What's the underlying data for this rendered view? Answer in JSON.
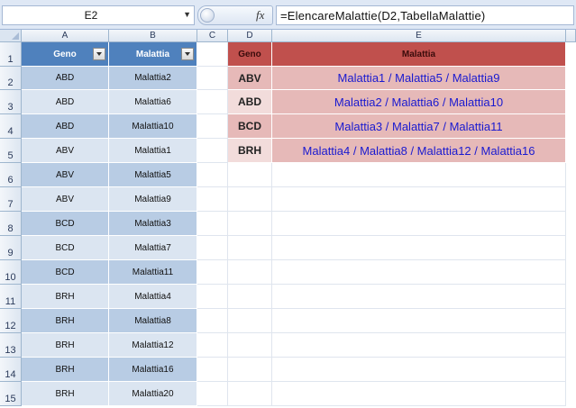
{
  "formula_bar": {
    "name_box": "E2",
    "fx_label": "fx",
    "formula": "=ElencareMalattie(D2,TabellaMalattie)"
  },
  "columns": [
    "A",
    "B",
    "C",
    "D",
    "E"
  ],
  "rows": [
    "1",
    "2",
    "3",
    "4",
    "5",
    "6",
    "7",
    "8",
    "9",
    "10",
    "11",
    "12",
    "13",
    "14",
    "15"
  ],
  "table1": {
    "headers": [
      "Geno",
      "Malattia"
    ],
    "rows": [
      [
        "ABD",
        "Malattia2"
      ],
      [
        "ABD",
        "Malattia6"
      ],
      [
        "ABD",
        "Malattia10"
      ],
      [
        "ABV",
        "Malattia1"
      ],
      [
        "ABV",
        "Malattia5"
      ],
      [
        "ABV",
        "Malattia9"
      ],
      [
        "BCD",
        "Malattia3"
      ],
      [
        "BCD",
        "Malattia7"
      ],
      [
        "BCD",
        "Malattia11"
      ],
      [
        "BRH",
        "Malattia4"
      ],
      [
        "BRH",
        "Malattia8"
      ],
      [
        "BRH",
        "Malattia12"
      ],
      [
        "BRH",
        "Malattia16"
      ],
      [
        "BRH",
        "Malattia20"
      ]
    ]
  },
  "table2": {
    "headers": [
      "Geno",
      "Malattia"
    ],
    "rows": [
      [
        "ABV",
        "Malattia1 / Malattia5 / Malattia9"
      ],
      [
        "ABD",
        "Malattia2 / Malattia6 / Malattia10"
      ],
      [
        "BCD",
        "Malattia3 / Malattia7 / Malattia11"
      ],
      [
        "BRH",
        "Malattia4 / Malattia8 / Malattia12 / Malattia16"
      ]
    ]
  },
  "colors": {
    "header_blue": "#4f81bd",
    "band_dark": "#b8cce4",
    "band_light": "#dbe5f1",
    "header_red": "#c0504d",
    "rose": "#e6b9b8",
    "rose_light": "#f2dcdb",
    "result_text": "#1a1ad0"
  }
}
